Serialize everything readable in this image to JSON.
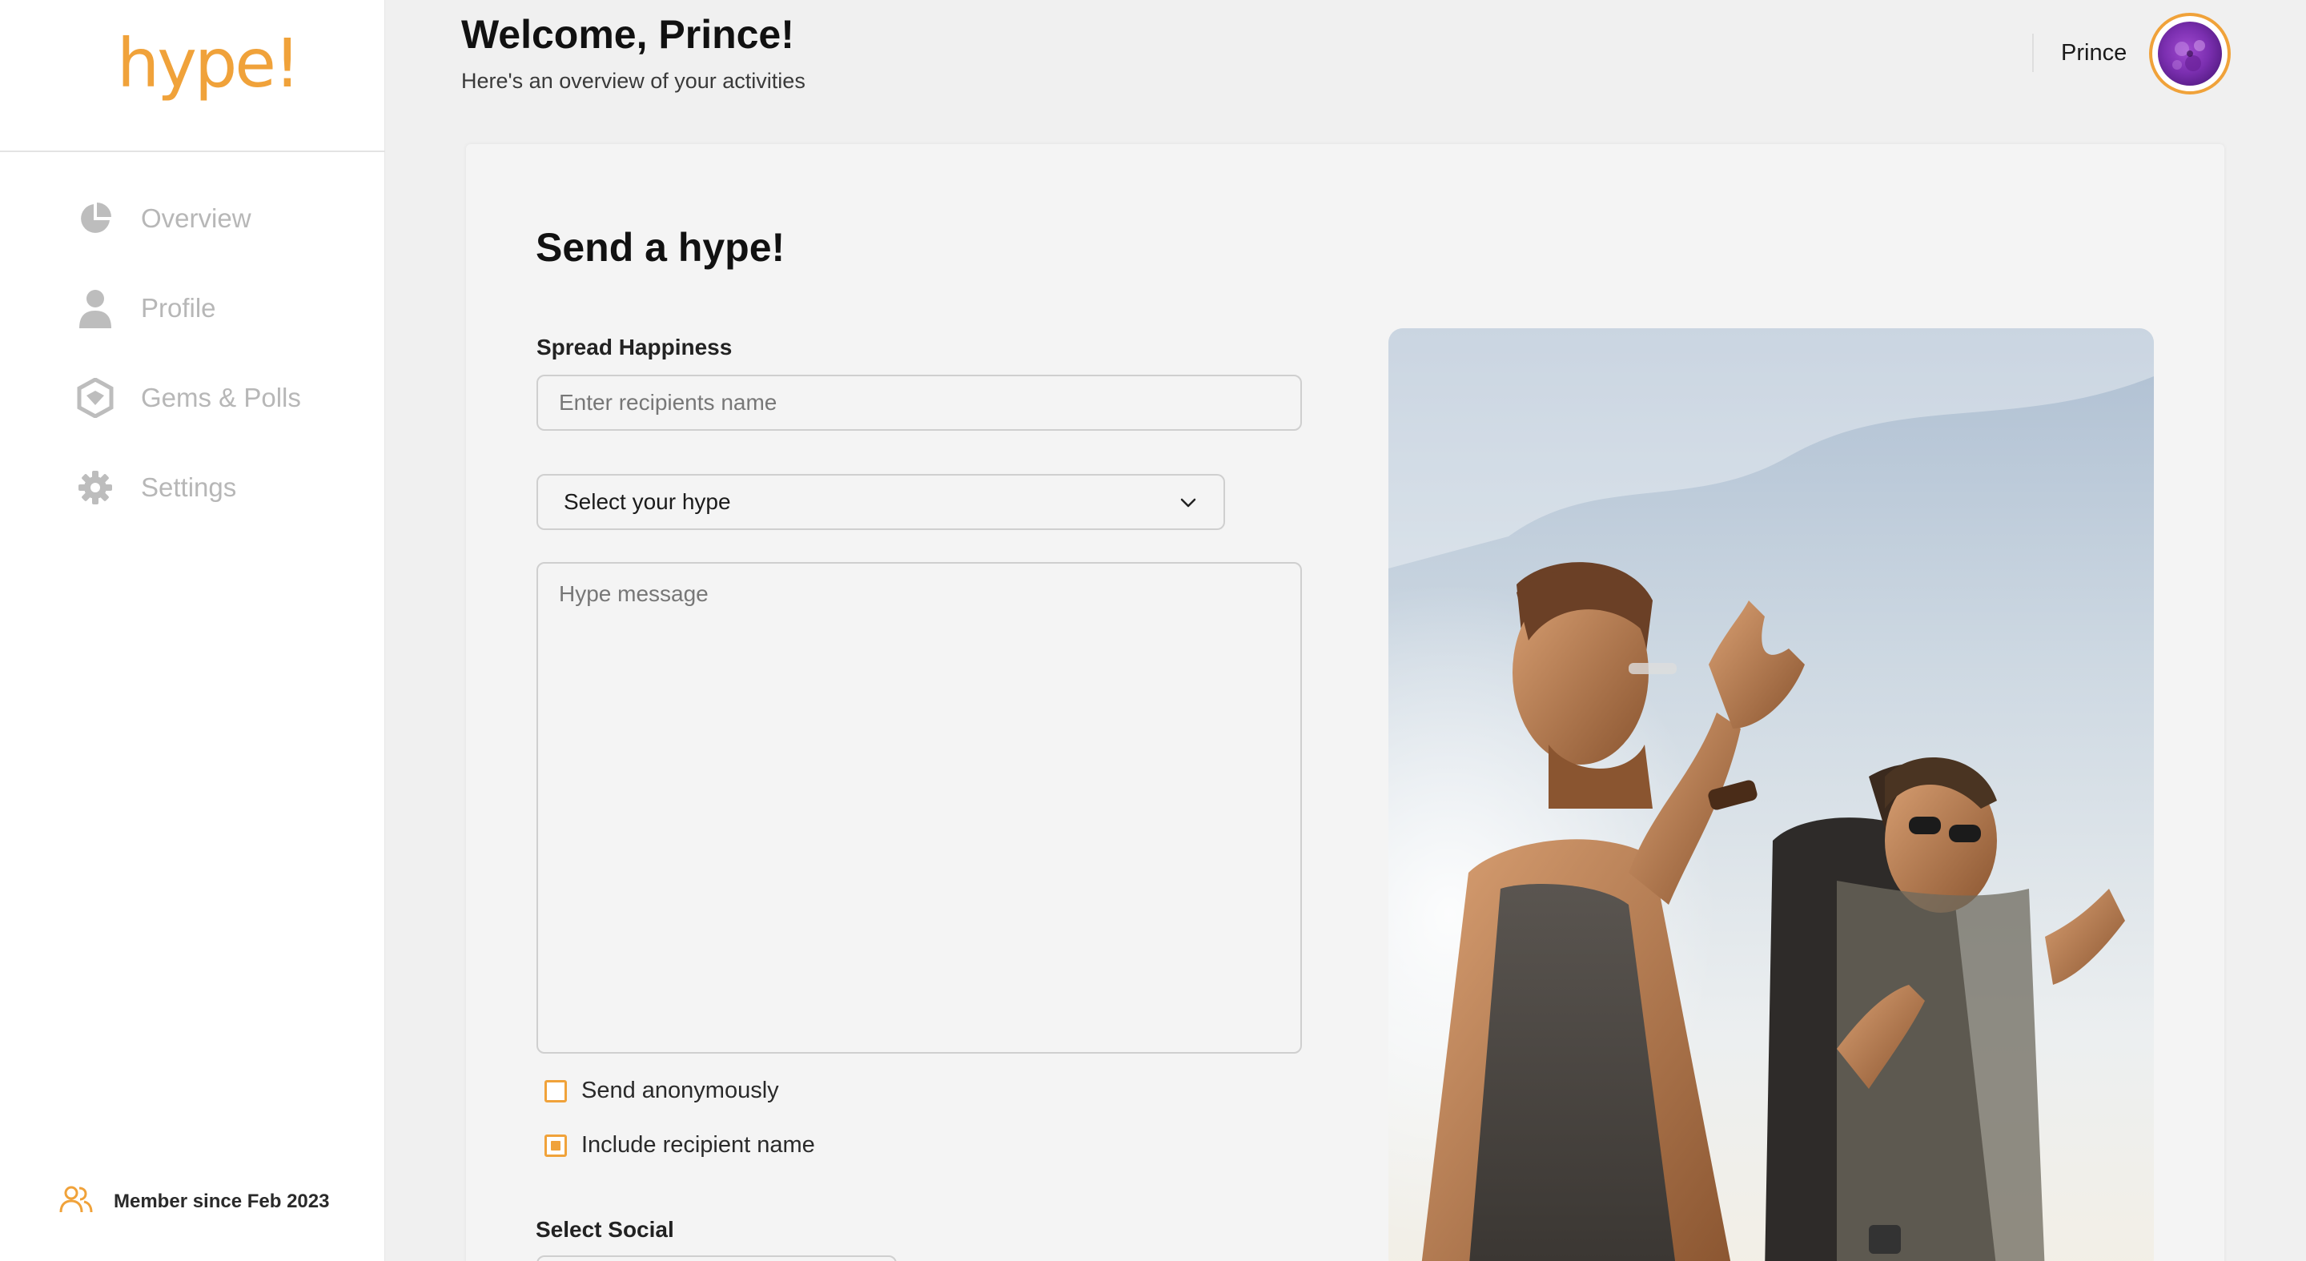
{
  "brand": {
    "logo": "hype!",
    "accent": "#f0a23a"
  },
  "sidebar": {
    "items": [
      {
        "label": "Overview",
        "icon": "pie-chart-icon"
      },
      {
        "label": "Profile",
        "icon": "user-icon"
      },
      {
        "label": "Gems & Polls",
        "icon": "gem-shield-icon"
      },
      {
        "label": "Settings",
        "icon": "gear-icon"
      }
    ],
    "member": {
      "label": "Member since Feb 2023",
      "icon": "users-icon"
    }
  },
  "header": {
    "title": "Welcome, Prince!",
    "subtitle": "Here's an overview of your activities",
    "user_name": "Prince"
  },
  "form": {
    "title": "Send a hype!",
    "spread_label": "Spread Happiness",
    "recipient_placeholder": "Enter recipients name",
    "hype_select_value": "Select your hype",
    "message_placeholder": "Hype message",
    "send_anonymously_label": "Send anonymously",
    "send_anonymously_checked": false,
    "include_name_label": "Include recipient name",
    "include_name_checked": true,
    "social_label": "Select Social"
  }
}
